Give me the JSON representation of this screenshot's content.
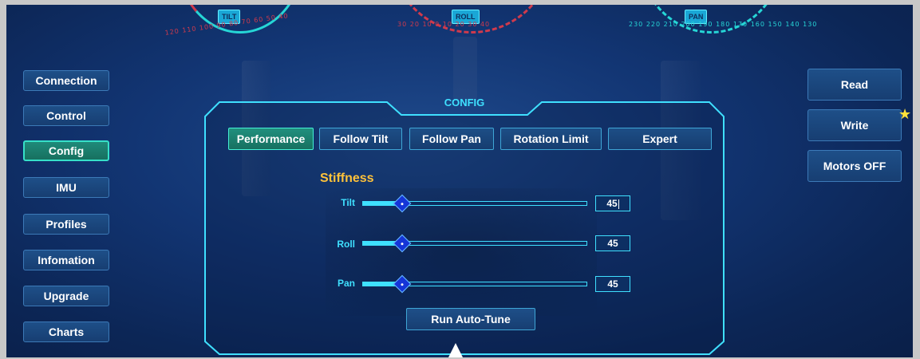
{
  "dials": {
    "tilt": {
      "label": "TILT",
      "ticks_left": "120 110 100 90 80 70 60 50 40",
      "ticks_right": ""
    },
    "roll": {
      "label": "ROLL",
      "ticks": "30 20 10 0 10 20 30 40"
    },
    "pan": {
      "label": "PAN",
      "ticks": "230 220 210 200 190 180 170 160 150 140 130"
    }
  },
  "nav": {
    "items": [
      {
        "label": "Connection"
      },
      {
        "label": "Control"
      },
      {
        "label": "Config"
      },
      {
        "label": "IMU"
      },
      {
        "label": "Profiles"
      },
      {
        "label": "Infomation"
      },
      {
        "label": "Upgrade"
      },
      {
        "label": "Charts"
      }
    ],
    "active": "Config"
  },
  "right": {
    "read_label": "Read",
    "write_label": "Write",
    "motors_label": "Motors OFF"
  },
  "panel": {
    "title": "CONFIG",
    "tabs": [
      {
        "label": "Performance",
        "active": true
      },
      {
        "label": "Follow Tilt",
        "active": false
      },
      {
        "label": "Follow Pan",
        "active": false
      },
      {
        "label": "Rotation Limit",
        "active": false
      },
      {
        "label": "Expert",
        "active": false
      }
    ],
    "stiffness": {
      "title": "Stiffness",
      "range": [
        0,
        255
      ],
      "sliders": [
        {
          "label": "Tilt",
          "value": "45",
          "level": 45
        },
        {
          "label": "Roll",
          "value": "45",
          "level": 45
        },
        {
          "label": "Pan",
          "value": "45",
          "level": 45
        }
      ]
    },
    "autotune_label": "Run Auto-Tune"
  },
  "colors": {
    "accent": "#3fe0ff",
    "active_tab": "#20907e",
    "stiffness_title": "#ffc23a",
    "thumb": "#1535d8",
    "dial_red": "#d03a4c",
    "dial_cyan": "#26d6d6"
  }
}
